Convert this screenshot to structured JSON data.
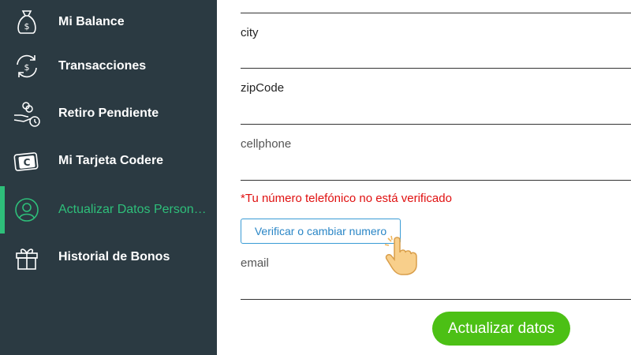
{
  "sidebar": {
    "items": [
      {
        "label": "Mi Balance",
        "icon": "money-bag-icon"
      },
      {
        "label": "Transacciones",
        "icon": "exchange-icon"
      },
      {
        "label": "Retiro Pendiente",
        "icon": "pending-withdrawal-icon"
      },
      {
        "label": "Mi Tarjeta Codere",
        "icon": "card-icon"
      },
      {
        "label": "Actualizar Datos Personal...",
        "icon": "user-icon",
        "active": true
      },
      {
        "label": "Historial de Bonos",
        "icon": "gift-icon"
      }
    ],
    "background": "#2b3a42",
    "accent": "#2ebf7a"
  },
  "form": {
    "city_label": "city",
    "zipcode_label": "zipCode",
    "cellphone_label": "cellphone",
    "phone_error": "*Tu número telefónico no está verificado",
    "verify_button": "Verificar o cambiar numero",
    "email_label": "email",
    "submit_button": "Actualizar datos",
    "error_color": "#e01010",
    "submit_color": "#4cc015"
  },
  "pointer": {
    "icon": "hand-pointer-icon"
  }
}
